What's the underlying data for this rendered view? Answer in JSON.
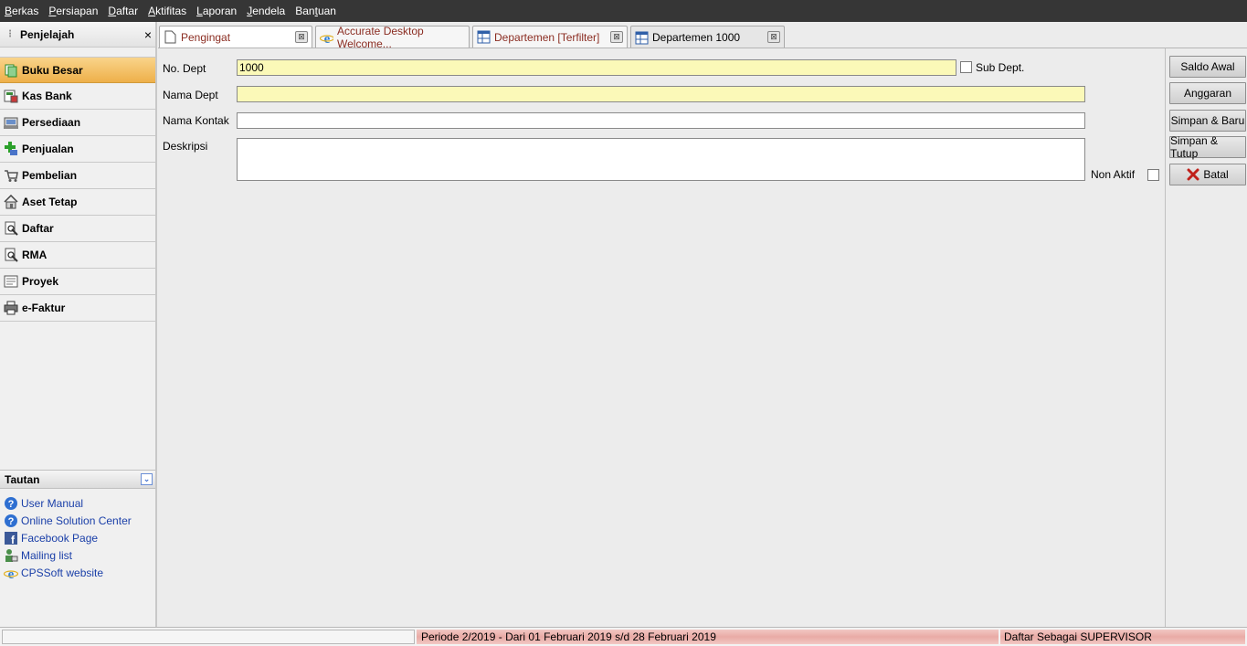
{
  "menu": [
    {
      "pre": "",
      "u": "B",
      "post": "erkas"
    },
    {
      "pre": "",
      "u": "P",
      "post": "ersiapan"
    },
    {
      "pre": "",
      "u": "D",
      "post": "aftar"
    },
    {
      "pre": "",
      "u": "A",
      "post": "ktifitas"
    },
    {
      "pre": "",
      "u": "L",
      "post": "aporan"
    },
    {
      "pre": "",
      "u": "J",
      "post": "endela"
    },
    {
      "pre": "Ban",
      "u": "t",
      "post": "uan"
    }
  ],
  "sidebar": {
    "title": "Penjelajah",
    "close": "×",
    "items": [
      {
        "label": "Buku Besar",
        "icon": "ledger-icon"
      },
      {
        "label": "Kas Bank",
        "icon": "bank-icon"
      },
      {
        "label": "Persediaan",
        "icon": "inventory-icon"
      },
      {
        "label": "Penjualan",
        "icon": "sales-icon"
      },
      {
        "label": "Pembelian",
        "icon": "cart-icon"
      },
      {
        "label": "Aset Tetap",
        "icon": "house-icon"
      },
      {
        "label": "Daftar",
        "icon": "document-icon"
      },
      {
        "label": "RMA",
        "icon": "rma-icon"
      },
      {
        "label": "Proyek",
        "icon": "project-icon"
      },
      {
        "label": "e-Faktur",
        "icon": "printer-icon"
      }
    ]
  },
  "tautan": {
    "title": "Tautan",
    "links": [
      {
        "label": "User Manual",
        "icon": "help-icon"
      },
      {
        "label": "Online Solution Center",
        "icon": "help-icon"
      },
      {
        "label": "Facebook Page",
        "icon": "facebook-icon"
      },
      {
        "label": "Mailing list",
        "icon": "mailing-icon"
      },
      {
        "label": "CPSSoft website",
        "icon": "ie-icon"
      }
    ]
  },
  "tabs": [
    {
      "label": "Pengingat",
      "icon": "page-icon"
    },
    {
      "label": "Accurate Desktop Welcome...",
      "icon": "ie-icon"
    },
    {
      "label": "Departemen [Terfilter]",
      "icon": "grid-icon"
    },
    {
      "label": "Departemen 1000",
      "icon": "grid-icon"
    }
  ],
  "form": {
    "no_dept_label": "No. Dept",
    "no_dept_value": "1000",
    "sub_dept_label": "Sub Dept.",
    "nama_dept_label": "Nama Dept",
    "nama_dept_value": "",
    "nama_kontak_label": "Nama Kontak",
    "nama_kontak_value": "",
    "deskripsi_label": "Deskripsi",
    "deskripsi_value": "",
    "non_aktif_label": "Non Aktif"
  },
  "buttons": {
    "saldo_awal": "Saldo Awal",
    "anggaran": "Anggaran",
    "simpan_baru": "Simpan & Baru",
    "simpan_tutup": "Simpan & Tutup",
    "batal": "Batal"
  },
  "status": {
    "periode": "Periode 2/2019 - Dari 01 Februari 2019 s/d 28 Februari 2019",
    "user": "Daftar Sebagai SUPERVISOR"
  },
  "colors": {
    "menubar": "#363636",
    "active_nav": "#eeb04a",
    "required_field": "#fbf9b8",
    "status_bar": "#e9aaa5",
    "cancel_x": "#c0201a"
  }
}
